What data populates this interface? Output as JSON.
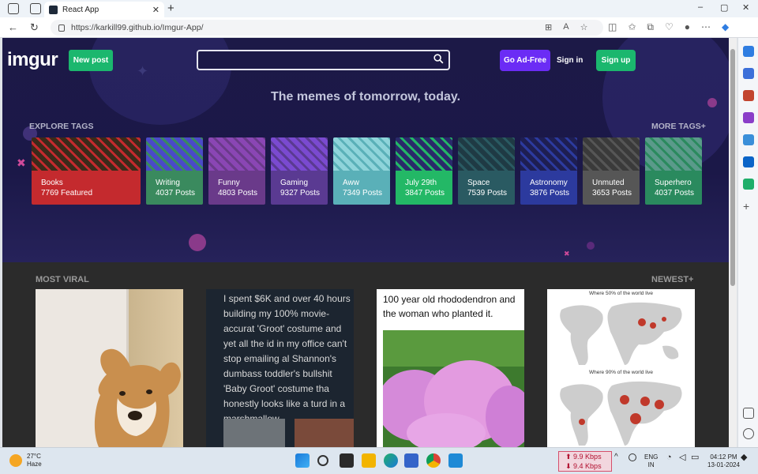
{
  "browser": {
    "tab_title": "React App",
    "tab_close": "✕",
    "new_tab": "+",
    "url": "https://karkill99.github.io/Imgur-App/",
    "window_controls": [
      "–",
      "▢",
      "✕"
    ]
  },
  "header": {
    "logo": "imgur",
    "new_post": "New post",
    "search_placeholder": "",
    "go_adfree": "Go Ad-Free",
    "sign_in": "Sign in",
    "sign_up": "Sign up"
  },
  "hero": {
    "tagline": "The memes of tomorrow, today.",
    "explore_tags": "EXPLORE TAGS",
    "more_tags": "MORE TAGS+"
  },
  "tags": [
    {
      "name": "Books",
      "count": "7769 Featured",
      "color": "#c42a2e",
      "pattern": "#3a2a1a"
    },
    {
      "name": "Writing",
      "count": "4037 Posts",
      "color": "#3a8a5e",
      "pattern": "#4a4ac8"
    },
    {
      "name": "Funny",
      "count": "4803 Posts",
      "color": "#6a3a8a",
      "pattern": "#8a46b4"
    },
    {
      "name": "Gaming",
      "count": "9327 Posts",
      "color": "#5a3a92",
      "pattern": "#7a4ad0"
    },
    {
      "name": "Aww",
      "count": "7349 Posts",
      "color": "#5ab0b8",
      "pattern": "#8fd4da"
    },
    {
      "name": "July 29th",
      "count": "3847 Posts",
      "color": "#23b866",
      "pattern": "#2a2a6a"
    },
    {
      "name": "Space",
      "count": "7539 Posts",
      "color": "#2a5a62",
      "pattern": "#1f3a44"
    },
    {
      "name": "Astronomy",
      "count": "3876 Posts",
      "color": "#2c3a9e",
      "pattern": "#1e1e52"
    },
    {
      "name": "Unmuted",
      "count": "3653 Posts",
      "color": "#565656",
      "pattern": "#3a3a3a"
    },
    {
      "name": "Superhero",
      "count": "4037 Posts",
      "color": "#2a8a5e",
      "pattern": "#5a9a8a"
    }
  ],
  "viral": {
    "title": "MOST VIRAL",
    "newest": "NEWEST+",
    "text_post": "I spent $6K and over 40 hours building my 100% movie-accurat 'Groot' costume and yet all the id in my office can't stop emailing al Shannon's dumbass toddler's bullshit 'Baby Groot' costume tha honestly looks like a turd in a marshmallow.",
    "rhodo_caption": "100 year old rhododendron and the woman who planted it.",
    "map_caption_1": "Where 50% of the world live",
    "map_caption_2": "Where 90% of the world live"
  },
  "taskbar": {
    "temp": "27°C",
    "weather": "Haze",
    "net_up": "⬆ 9.9 Kbps",
    "net_down": "⬇ 9.4 Kbps",
    "lang1": "ENG",
    "lang2": "IN",
    "time": "04:12 PM",
    "date": "13-01-2024"
  }
}
